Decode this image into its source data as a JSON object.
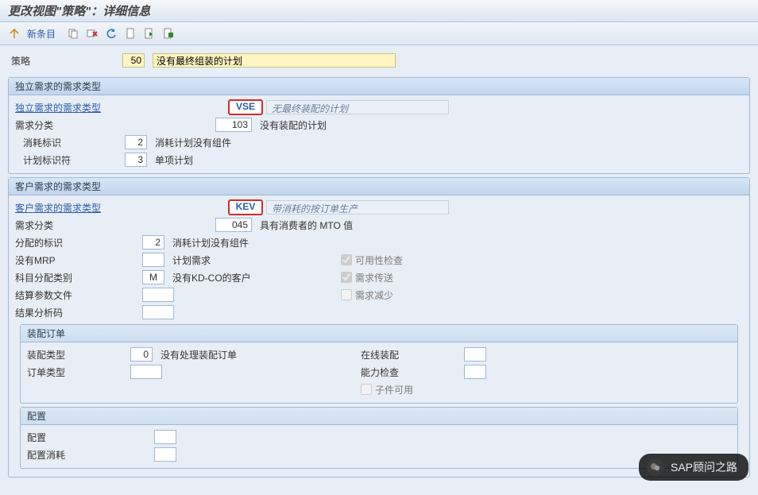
{
  "title": "更改视图\"策略\"：详细信息",
  "toolbar": {
    "new_entry": "新条目"
  },
  "header": {
    "label": "策略",
    "code": "50",
    "desc": "没有最终组装的计划"
  },
  "section1": {
    "title": "独立需求的需求类型",
    "req_type_label": "独立需求的需求类型",
    "req_type_val": "VSE",
    "req_type_desc": "无最终装配的计划",
    "req_class_label": "需求分类",
    "req_class_val": "103",
    "req_class_desc": "没有装配的计划",
    "consume_label": "消耗标识",
    "consume_val": "2",
    "consume_desc": "消耗计划没有组件",
    "plan_label": "计划标识符",
    "plan_val": "3",
    "plan_desc": "单项计划"
  },
  "section2": {
    "title": "客户需求的需求类型",
    "req_type_label": "客户需求的需求类型",
    "req_type_val": "KEV",
    "req_type_desc": "带消耗的按订单生产",
    "req_class_label": "需求分类",
    "req_class_val": "045",
    "req_class_desc": "具有消费者的 MTO 值",
    "alloc_label": "分配的标识",
    "alloc_val": "2",
    "alloc_desc": "消耗计划没有组件",
    "nomrp_label": "没有MRP",
    "planreq_label": "计划需求",
    "account_label": "科目分配类别",
    "account_val": "M",
    "account_desc": "没有KD-CO的客户",
    "resultfile_label": "结算参数文件",
    "resultcode_label": "结果分析码",
    "avail_label": "可用性检查",
    "reqxfer_label": "需求传送",
    "reqred_label": "需求减少"
  },
  "section3": {
    "title": "装配订单",
    "asm_type_label": "装配类型",
    "asm_type_val": "0",
    "asm_type_desc": "没有处理装配订单",
    "order_type_label": "订单类型",
    "online_label": "在线装配",
    "capacity_label": "能力检查",
    "childavail_label": "子件可用"
  },
  "section4": {
    "title": "配置",
    "config_label": "配置",
    "config_consume_label": "配置消耗"
  },
  "watermark": "SAP顾问之路"
}
